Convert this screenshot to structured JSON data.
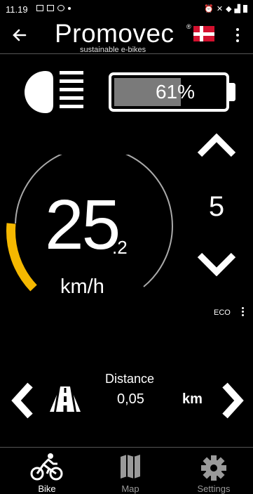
{
  "status_bar": {
    "time": "11.19"
  },
  "header": {
    "brand": "Promovec",
    "brand_mark": "®",
    "tagline": "sustainable e-bikes"
  },
  "battery": {
    "label": "61%",
    "level": 0.61,
    "fill_color": "#7a7a7a"
  },
  "speed": {
    "integer": "25",
    "decimal": ".2",
    "unit": "km/h",
    "gauge_color": "#f5b800"
  },
  "assist": {
    "level": "5",
    "mode": "ECO"
  },
  "trip": {
    "label": "Distance",
    "value": "0,05",
    "unit": "km"
  },
  "nav": [
    {
      "label": "Bike",
      "icon": "bike-icon",
      "active": true
    },
    {
      "label": "Map",
      "icon": "map-icon",
      "active": false
    },
    {
      "label": "Settings",
      "icon": "gear-icon",
      "active": false
    }
  ],
  "colors": {
    "background": "#000000",
    "accent_gauge": "#f5b800",
    "inactive": "#9a9a9a"
  }
}
